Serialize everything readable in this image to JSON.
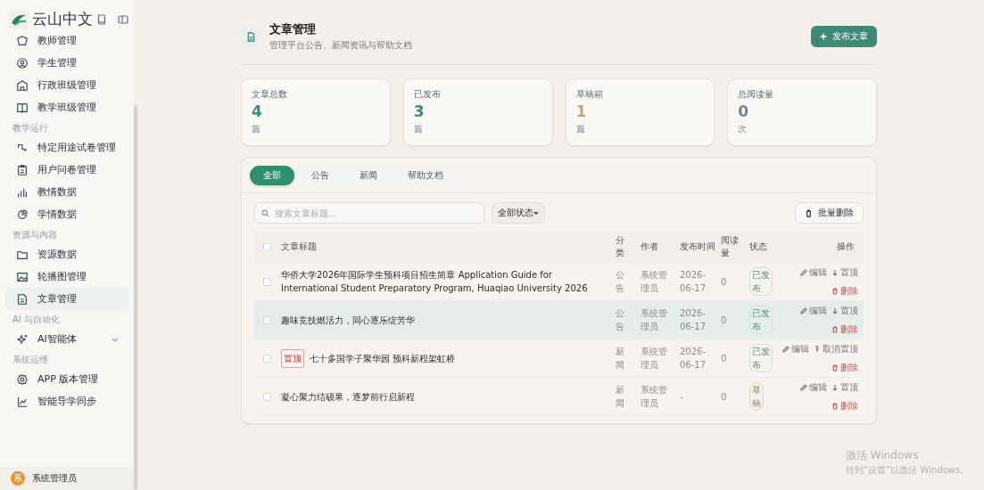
{
  "sidebar": {
    "logo": "云山中文",
    "groups": [
      {
        "items": [
          {
            "label": "教师管理",
            "selected": false
          },
          {
            "label": "学生管理",
            "selected": false
          },
          {
            "label": "行政班级管理",
            "selected": false
          },
          {
            "label": "教学班级管理",
            "selected": false
          }
        ]
      },
      {
        "heading": "教学运行",
        "items": [
          {
            "label": "特定用途试卷管理",
            "selected": false
          },
          {
            "label": "用户问卷管理",
            "selected": false
          },
          {
            "label": "教情数据",
            "selected": false
          },
          {
            "label": "学情数据",
            "selected": false
          }
        ]
      },
      {
        "heading": "资源与内容",
        "items": [
          {
            "label": "资源数据",
            "selected": false
          },
          {
            "label": "轮播图管理",
            "selected": false
          },
          {
            "label": "文章管理",
            "selected": true
          }
        ]
      },
      {
        "heading": "AI 与自动化",
        "items": [
          {
            "label": "AI智能体",
            "selected": false,
            "expanded": false
          }
        ]
      },
      {
        "heading": "系统运维",
        "items": [
          {
            "label": "APP 版本管理",
            "selected": false
          },
          {
            "label": "智能导学同步",
            "selected": false
          }
        ]
      }
    ],
    "user": {
      "avatar": "系",
      "name": "系统管理员"
    }
  },
  "header": {
    "title": "文章管理",
    "subtitle": "管理平台公告、新闻资讯与帮助文档",
    "action": "发布文章"
  },
  "stats": [
    {
      "label": "文章总数",
      "value": "4",
      "unit": "篇",
      "color": "#3f8a78"
    },
    {
      "label": "已发布",
      "value": "3",
      "unit": "篇",
      "color": "#3f8a78"
    },
    {
      "label": "草稿箱",
      "value": "1",
      "unit": "篇",
      "color": "#c4a27c"
    },
    {
      "label": "总阅读量",
      "value": "0",
      "unit": "次",
      "color": "#6b8a80"
    }
  ],
  "tabs": [
    {
      "label": "全部",
      "selected": true
    },
    {
      "label": "公告",
      "selected": false
    },
    {
      "label": "新闻",
      "selected": false
    },
    {
      "label": "帮助文档",
      "selected": false
    }
  ],
  "toolbar": {
    "search_placeholder": "搜索文章标题...",
    "status_filter": "全部状态",
    "bulk_delete": "批量删除"
  },
  "table": {
    "select_all_checked": false,
    "columns": [
      "文章标题",
      "分类",
      "作者",
      "发布时间",
      "阅读量",
      "状态",
      "操作"
    ],
    "rows": [
      {
        "checked": false,
        "highlighted": false,
        "title": "华侨大学2026年国际学生预科项目招生简章 Application Guide for International Student Preparatory Program, Huaqiao University 2026",
        "category": "公告",
        "author": "系统管理员",
        "date": "2026-06-17",
        "reads": "0",
        "status": {
          "text": "已发布",
          "kind": "published"
        },
        "actions": [
          {
            "label": "编辑",
            "kind": "edit"
          },
          {
            "label": "置顶",
            "kind": "pin"
          },
          {
            "label": "删除",
            "kind": "delete"
          }
        ]
      },
      {
        "checked": false,
        "highlighted": true,
        "title": "趣味竞技燃活力，同心逐乐绽芳华",
        "category": "公告",
        "author": "系统管理员",
        "date": "2026-06-17",
        "reads": "0",
        "status": {
          "text": "已发布",
          "kind": "published"
        },
        "actions": [
          {
            "label": "编辑",
            "kind": "edit"
          },
          {
            "label": "置顶",
            "kind": "pin"
          },
          {
            "label": "删除",
            "kind": "delete"
          }
        ]
      },
      {
        "checked": false,
        "highlighted": false,
        "tag": "置顶",
        "title": "七十多国学子聚华园 预科新程架虹桥",
        "category": "新闻",
        "author": "系统管理员",
        "date": "2026-06-17",
        "reads": "0",
        "status": {
          "text": "已发布",
          "kind": "published"
        },
        "actions": [
          {
            "label": "编辑",
            "kind": "edit"
          },
          {
            "label": "取消置顶",
            "kind": "unpin"
          },
          {
            "label": "删除",
            "kind": "delete"
          }
        ]
      },
      {
        "checked": false,
        "highlighted": false,
        "title": "凝心聚力结硕果，逐梦前行启新程",
        "category": "新闻",
        "author": "系统管理员",
        "date": "-",
        "reads": "0",
        "status": {
          "text": "草稿",
          "kind": "draft"
        },
        "actions": [
          {
            "label": "编辑",
            "kind": "edit"
          },
          {
            "label": "置顶",
            "kind": "pin"
          },
          {
            "label": "删除",
            "kind": "delete"
          }
        ]
      }
    ]
  },
  "windows_activation": {
    "title": "激活 Windows",
    "subtitle": "转到“设置”以激活 Windows。"
  }
}
